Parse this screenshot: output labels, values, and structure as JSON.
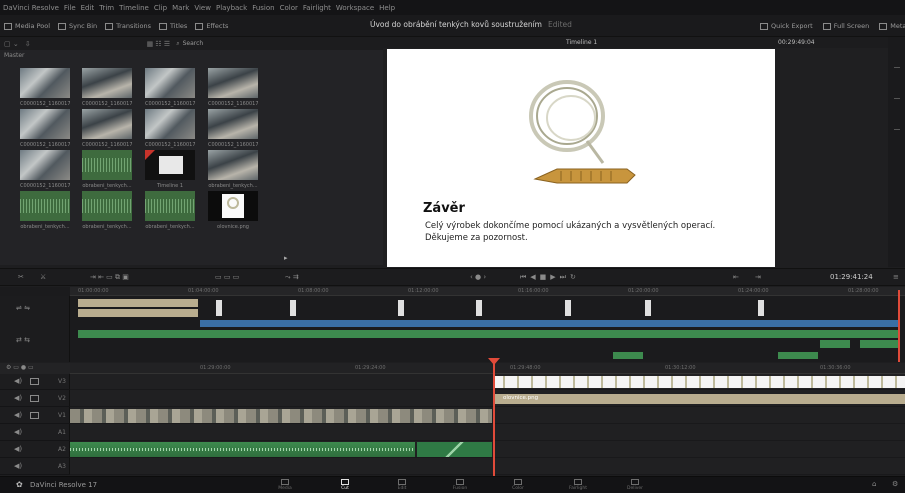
{
  "menu": [
    "DaVinci Resolve",
    "File",
    "Edit",
    "Trim",
    "Timeline",
    "Clip",
    "Mark",
    "View",
    "Playback",
    "Fusion",
    "Color",
    "Fairlight",
    "Workspace",
    "Help"
  ],
  "toolbar": {
    "left": [
      "Media Pool",
      "Sync Bin",
      "Transitions",
      "Titles",
      "Effects"
    ],
    "right": [
      "Quick Export",
      "Full Screen",
      "Metadata"
    ],
    "project_title": "Úvod do obrábění tenkých kovů soustružením",
    "project_status": "Edited"
  },
  "media_pool": {
    "search_label": "Search",
    "bin_label": "Master",
    "clips": [
      {
        "name": "C0000152_1160017...",
        "kind": "video"
      },
      {
        "name": "C0000152_1160017...",
        "kind": "video2"
      },
      {
        "name": "C0000152_1160017...",
        "kind": "video"
      },
      {
        "name": "C0000152_1160017...",
        "kind": "video2"
      },
      {
        "name": "C0000152_1160017...",
        "kind": "video"
      },
      {
        "name": "C0000152_1160017...",
        "kind": "video2"
      },
      {
        "name": "C0000152_1160017...",
        "kind": "video"
      },
      {
        "name": "C0000152_1160017...",
        "kind": "video2"
      },
      {
        "name": "C0000152_1160017...",
        "kind": "video"
      },
      {
        "name": "obrabeni_tenkych...",
        "kind": "audio"
      },
      {
        "name": "Timeline 1",
        "kind": "timeline-clip"
      },
      {
        "name": "obrabeni_tenkych...",
        "kind": "video2"
      },
      {
        "name": "obrabeni_tenkych...",
        "kind": "audio"
      },
      {
        "name": "obrabeni_tenkych...",
        "kind": "audio"
      },
      {
        "name": "obrabeni_tenkych...",
        "kind": "audio"
      },
      {
        "name": "olovnice.png",
        "kind": "still"
      }
    ]
  },
  "viewer": {
    "timeline_name": "Timeline 1",
    "zoom": "00:29:49:04",
    "slide_heading": "Závěr",
    "slide_line1": "Celý výrobek dokončíme pomocí ukázaných a vysvětlených operací.",
    "slide_line2": "Děkujeme za pozornost."
  },
  "transport": {
    "timecode": "01:29:41:24"
  },
  "upper_ruler": [
    "01:00:00:00",
    "01:04:00:00",
    "01:08:00:00",
    "01:12:00:00",
    "01:16:00:00",
    "01:20:00:00",
    "01:24:00:00",
    "01:28:00:00"
  ],
  "lower_ruler": [
    "01:29:00:00",
    "01:29:24:00",
    "01:29:48:00",
    "01:30:12:00",
    "01:30:36:00"
  ],
  "tracks": [
    {
      "label": "V3",
      "type": "video"
    },
    {
      "label": "V2",
      "type": "video"
    },
    {
      "label": "V1",
      "type": "video"
    },
    {
      "label": "A1",
      "type": "audio"
    },
    {
      "label": "A2",
      "type": "audio"
    },
    {
      "label": "A3",
      "type": "audio"
    }
  ],
  "clips_on_timeline": {
    "title_clip": "olovnice.png"
  },
  "pages": [
    {
      "label": "Media",
      "active": false
    },
    {
      "label": "Cut",
      "active": true
    },
    {
      "label": "Edit",
      "active": false
    },
    {
      "label": "Fusion",
      "active": false
    },
    {
      "label": "Color",
      "active": false
    },
    {
      "label": "Fairlight",
      "active": false
    },
    {
      "label": "Deliver",
      "active": false
    }
  ],
  "app_name": "DaVinci Resolve 17",
  "colors": {
    "accent": "#e14b3a",
    "video_clip": "#3a6fa5",
    "audio_clip": "#3d8a4e",
    "title_clip": "#b9ad8f"
  }
}
